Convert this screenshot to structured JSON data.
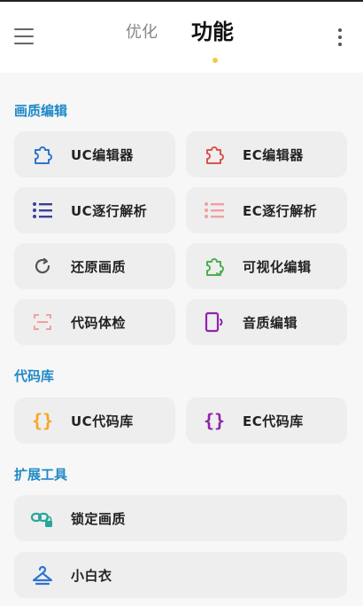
{
  "header": {
    "tab_optimize": "优化",
    "tab_function": "功能",
    "accent_dot_color": "#f2c94c",
    "menu_icon": "hamburger-menu-icon",
    "more_icon": "more-vertical-icon"
  },
  "sections": {
    "quality_edit": "画质编辑",
    "code_library": "代码库",
    "extensions": "扩展工具"
  },
  "items": {
    "uc_editor": "UC编辑器",
    "ec_editor": "EC编辑器",
    "uc_line_parse": "UC逐行解析",
    "ec_line_parse": "EC逐行解析",
    "restore_quality": "还原画质",
    "visual_edit": "可视化编辑",
    "code_check": "代码体检",
    "audio_edit": "音质编辑",
    "uc_code_lib": "UC代码库",
    "ec_code_lib": "EC代码库",
    "lock_quality": "锁定画质",
    "little_white_coat": "小白衣"
  },
  "colors": {
    "section_title": "#1e88c8",
    "blue": "#2f74d0",
    "red": "#d9534f",
    "navy": "#3b3f9c",
    "pink": "#f0a0a0",
    "gray": "#555555",
    "green": "#4caf50",
    "purple": "#8e24aa",
    "orange": "#f5a623",
    "teal": "#26a69a"
  }
}
